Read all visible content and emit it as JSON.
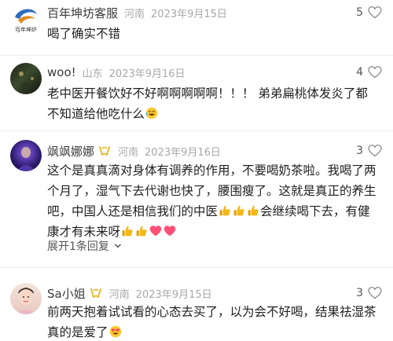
{
  "comments": [
    {
      "name": "百年坤坊客服",
      "region": "河南",
      "date": "2023年9月15日",
      "likes": "5",
      "text": "喝了确实不错"
    },
    {
      "name": "woo!",
      "region": "山东",
      "date": "2023年9月16日",
      "likes": "4",
      "text": "老中医开餐饮好不好啊啊啊啊啊！！！ 弟弟扁桃体发炎了都不知道给他吃什么"
    },
    {
      "name": "飒飒娜娜",
      "region": "河南",
      "date": "2023年9月16日",
      "likes": "3",
      "text_part1": "这个是真真滴对身体有调养的作用，不要喝奶茶啦。我喝了两个月了，湿气下去代谢也快了，腰围瘦了。这就是真正的养生吧，中国人还是相信我们的中医",
      "text_part2": "会继续喝下去，有健康才有未来呀",
      "replies": "展开1条回复"
    },
    {
      "name": "Sa小姐",
      "region": "河南",
      "date": "2023年9月15日",
      "likes": "3",
      "text": "前两天抱着试试看的心态去买了，以为会不好喝，结果祛湿茶真的是爱了"
    }
  ],
  "logo_text": "百年坤坊",
  "colors": {
    "accent": "#e6b422",
    "thumb": "#f5b817",
    "heart": "#ff4f75",
    "muted": "#a8a8a8"
  }
}
